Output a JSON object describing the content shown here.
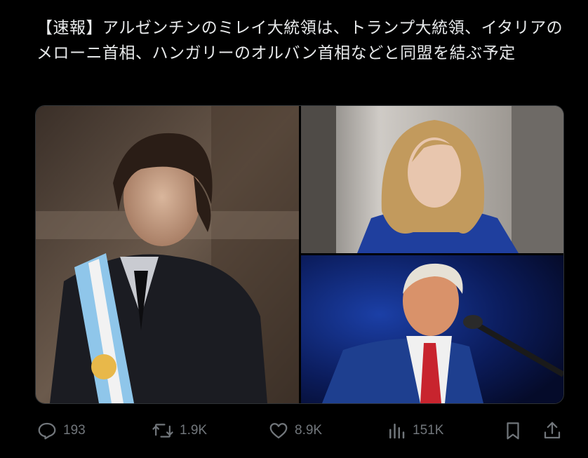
{
  "post": {
    "text": "【速報】アルゼンチンのミレイ大統領は、トランプ大統領、イタリアのメローニ首相、ハンガリーのオルバン首相などと同盟を結ぶ予定"
  },
  "media": {
    "images": [
      {
        "name": "photo-left"
      },
      {
        "name": "photo-top-right"
      },
      {
        "name": "photo-bottom-right"
      }
    ]
  },
  "actions": {
    "reply": {
      "icon": "reply-icon",
      "count": "193"
    },
    "repost": {
      "icon": "repost-icon",
      "count": "1.9K"
    },
    "like": {
      "icon": "heart-icon",
      "count": "8.9K"
    },
    "views": {
      "icon": "views-icon",
      "count": "151K"
    },
    "bookmark": {
      "icon": "bookmark-icon"
    },
    "share": {
      "icon": "share-icon"
    }
  },
  "colors": {
    "background": "#000000",
    "text": "#e7e9ea",
    "muted": "#71767b",
    "border": "#2f3336"
  }
}
